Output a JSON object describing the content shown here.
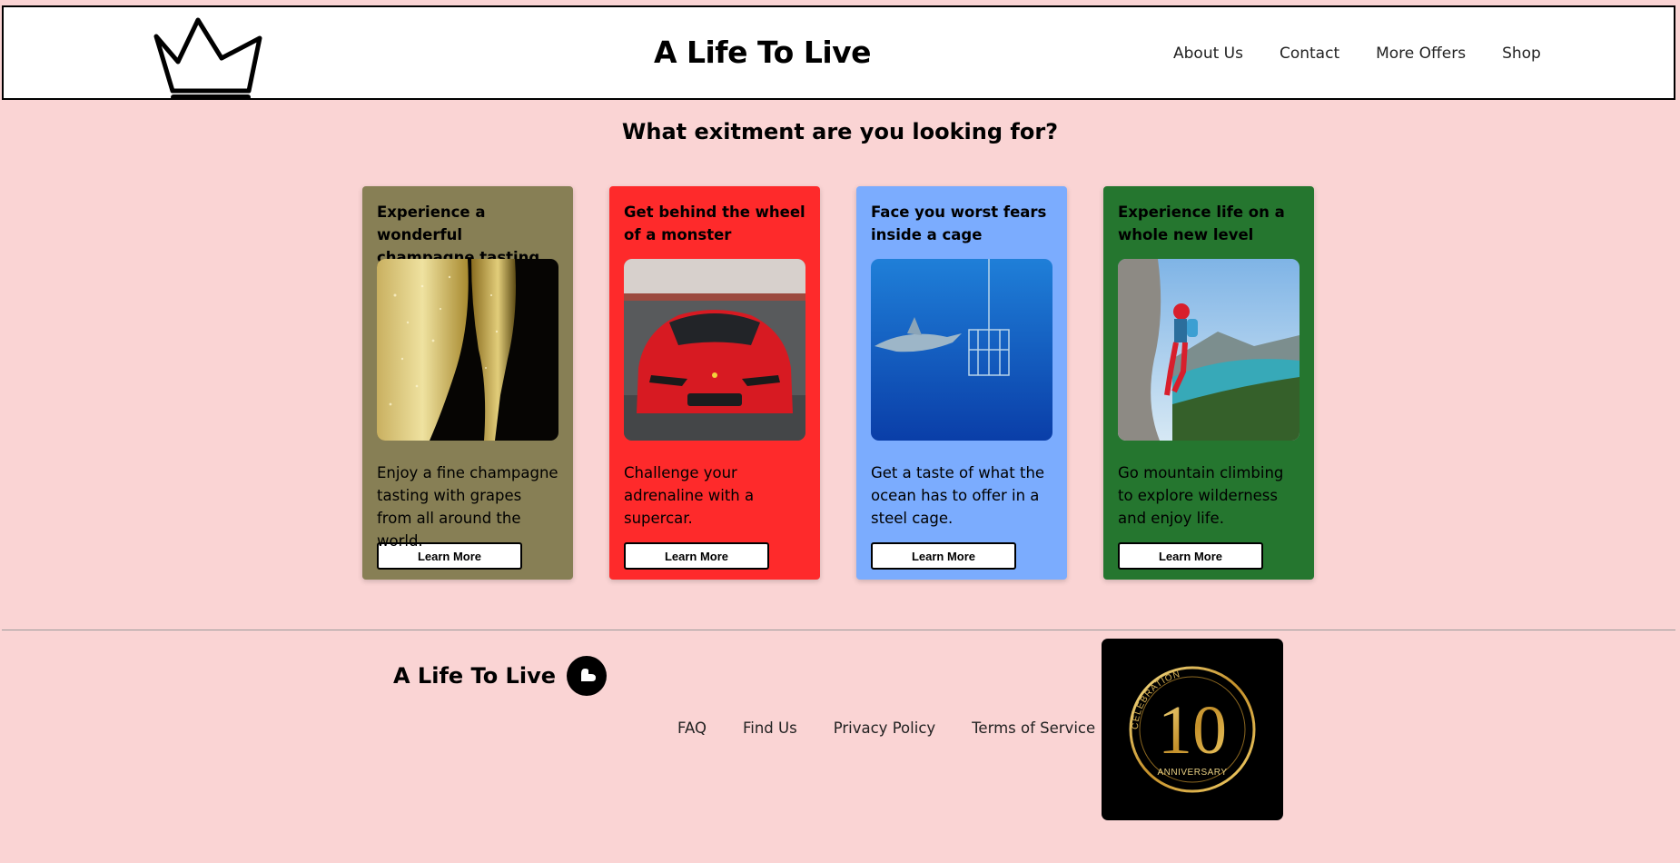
{
  "header": {
    "title": "A Life To Live",
    "logo_icon": "crown-icon",
    "nav": [
      {
        "label": "About Us"
      },
      {
        "label": "Contact"
      },
      {
        "label": "More Offers"
      },
      {
        "label": "Shop"
      }
    ]
  },
  "main": {
    "headline": "What exitment are you looking for?",
    "cards": [
      {
        "title": "Experience a wonderful champagne tasting",
        "image": "champagne-glasses-photo",
        "text": "Enjoy a fine champagne tasting with grapes from all around the world.",
        "button": "Learn More",
        "color": "#877f55"
      },
      {
        "title": "Get behind the wheel of a monster",
        "image": "red-supercar-photo",
        "text": "Challenge your adrenaline with a supercar.",
        "button": "Learn More",
        "color": "#fe2a2b"
      },
      {
        "title": "Face you worst fears inside a cage",
        "image": "shark-cage-dive-photo",
        "text": "Get a taste of what the ocean has to offer in a steel cage.",
        "button": "Learn More",
        "color": "#7bacfe"
      },
      {
        "title": "Experience life on a whole new level",
        "image": "mountain-climber-photo",
        "text": "Go mountain climbing to explore wilderness and enjoy life.",
        "button": "Learn More",
        "color": "#25762f"
      }
    ]
  },
  "footer": {
    "brand": "A Life To Live",
    "brand_icon": "heart-badge-icon",
    "links": [
      {
        "label": "FAQ"
      },
      {
        "label": "Find Us"
      },
      {
        "label": "Privacy Policy"
      },
      {
        "label": "Terms of Service"
      }
    ],
    "badge": {
      "arc_text": "CELEBRATION",
      "number": "10",
      "caption": "ANNIVERSARY"
    }
  }
}
